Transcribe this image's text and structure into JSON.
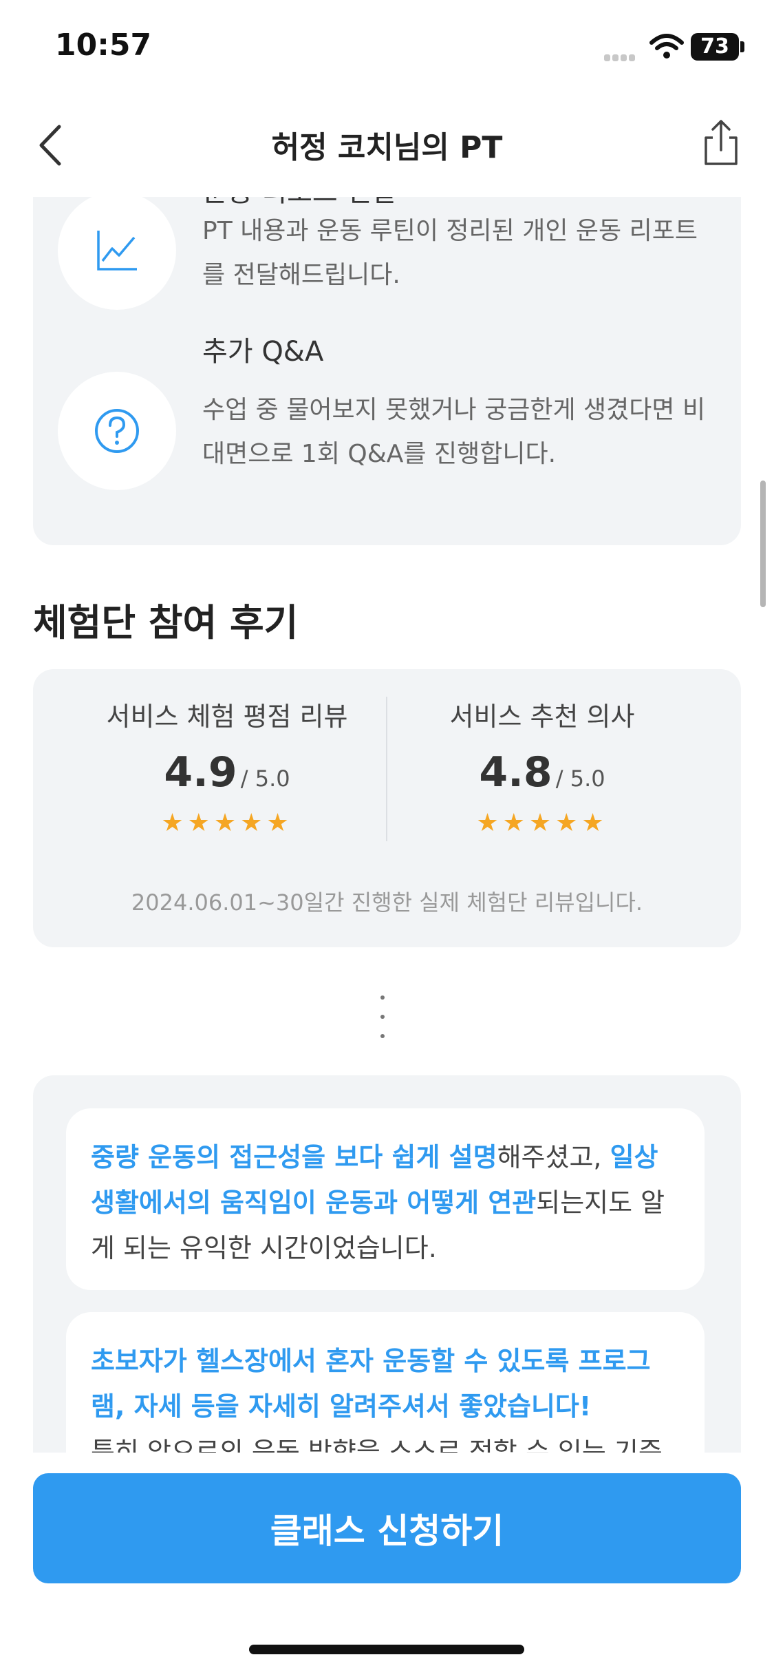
{
  "status_bar": {
    "time": "10:57",
    "battery": "73"
  },
  "header": {
    "title": "허정 코치님의 PT"
  },
  "features": [
    {
      "title": "운동 리포트 전달",
      "desc": "PT 내용과 운동 루틴이 정리된 개인 운동 리포트를 전달해드립니다.",
      "icon": "chart-icon"
    },
    {
      "title": "추가 Q&A",
      "desc": "수업 중 물어보지 못했거나 궁금한게 생겼다면 비대면으로 1회 Q&A를 진행합니다.",
      "icon": "question-icon"
    }
  ],
  "reviews": {
    "section_title": "체험단 참여 후기",
    "rating_label": "서비스 체험 평점 리뷰",
    "rating_value": "4.9",
    "rating_max": "/ 5.0",
    "recommend_label": "서비스 추천 의사",
    "recommend_value": "4.8",
    "recommend_max": "/ 5.0",
    "stars": "★★★★★",
    "note": "2024.06.01~30일간 진행한 실제 체험단 리뷰입니다."
  },
  "quotes": [
    {
      "parts": [
        {
          "text": "중량 운동의 접근성을 보다 쉽게 설명",
          "hl": true
        },
        {
          "text": "해주셨고, ",
          "hl": false
        },
        {
          "text": "일상 생활에서의 움직임이 운동과 어떻게 연관",
          "hl": true
        },
        {
          "text": "되는지도 알게 되는 유익한 시간이었습니다.",
          "hl": false
        }
      ]
    },
    {
      "parts": [
        {
          "text": "초보자가 헬스장에서 혼자 운동할 수 있도록 프로그램, 자세 등을 자세히 알려주셔서 좋았습니다!",
          "hl": true
        },
        {
          "text": "특히 앞으로의 운동 방향을 스스로 정할 수 있는 기준",
          "hl": false
        }
      ]
    }
  ],
  "cta": {
    "label": "클래스 신청하기"
  },
  "colors": {
    "accent": "#2f9af0",
    "card_bg": "#f2f4f6",
    "star": "#f5a623"
  }
}
